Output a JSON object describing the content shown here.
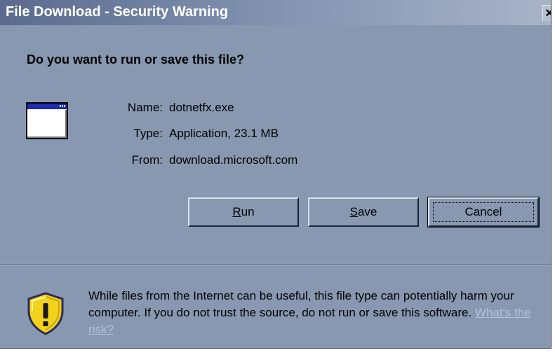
{
  "window": {
    "title": "File Download - Security Warning",
    "close_label": "×"
  },
  "dialog": {
    "question": "Do you want to run or save this file?",
    "file": {
      "name_label": "Name:",
      "name_value": "dotnetfx.exe",
      "type_label": "Type:",
      "type_value": "Application, 23.1 MB",
      "from_label": "From:",
      "from_value": "download.microsoft.com"
    },
    "buttons": {
      "run_mnemonic": "R",
      "run_rest": "un",
      "save_mnemonic": "S",
      "save_rest": "ave",
      "cancel": "Cancel"
    },
    "warning_text": "While files from the Internet can be useful, this file type can potentially harm your computer. If you do not trust the source, do not run or save this software.",
    "risk_link": "What's the risk?"
  },
  "icons": {
    "file": "application-window-icon",
    "warning": "security-shield-warning-icon"
  },
  "colors": {
    "dialog_background": "#8798b0",
    "link": "#b4c2d8",
    "shield_yellow": "#f2d21a"
  }
}
